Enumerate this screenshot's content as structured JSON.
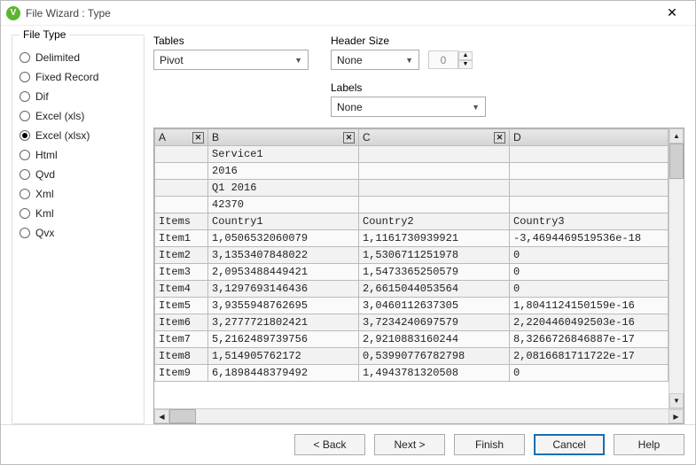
{
  "title": "File Wizard : Type",
  "app_icon_letter": "V",
  "filetype": {
    "legend": "File Type",
    "options": [
      {
        "label": "Delimited",
        "selected": false
      },
      {
        "label": "Fixed Record",
        "selected": false
      },
      {
        "label": "Dif",
        "selected": false
      },
      {
        "label": "Excel (xls)",
        "selected": false
      },
      {
        "label": "Excel (xlsx)",
        "selected": true
      },
      {
        "label": "Html",
        "selected": false
      },
      {
        "label": "Qvd",
        "selected": false
      },
      {
        "label": "Xml",
        "selected": false
      },
      {
        "label": "Kml",
        "selected": false
      },
      {
        "label": "Qvx",
        "selected": false
      }
    ]
  },
  "controls": {
    "tables": {
      "label": "Tables",
      "value": "Pivot"
    },
    "header_size": {
      "label": "Header Size",
      "value": "None",
      "spinner": "0"
    },
    "labels": {
      "label": "Labels",
      "value": "None"
    }
  },
  "grid": {
    "columns": [
      {
        "name": "A",
        "closable": true
      },
      {
        "name": "B",
        "closable": true
      },
      {
        "name": "C",
        "closable": true
      },
      {
        "name": "D",
        "closable": false
      }
    ],
    "rows": [
      {
        "a": "",
        "b": "Service1",
        "c": "",
        "d": ""
      },
      {
        "a": "",
        "b": "2016",
        "c": "",
        "d": ""
      },
      {
        "a": "",
        "b": "Q1 2016",
        "c": "",
        "d": ""
      },
      {
        "a": "",
        "b": "42370",
        "c": "",
        "d": ""
      },
      {
        "a": "Items",
        "b": "Country1",
        "c": "Country2",
        "d": "Country3"
      },
      {
        "a": "Item1",
        "b": "1,0506532060079",
        "c": "1,1161730939921",
        "d": "-3,4694469519536e-18"
      },
      {
        "a": "Item2",
        "b": "3,1353407848022",
        "c": "1,5306711251978",
        "d": "0"
      },
      {
        "a": "Item3",
        "b": "2,0953488449421",
        "c": "1,5473365250579",
        "d": "0"
      },
      {
        "a": "Item4",
        "b": "3,1297693146436",
        "c": "2,6615044053564",
        "d": "0"
      },
      {
        "a": "Item5",
        "b": "3,9355948762695",
        "c": "3,0460112637305",
        "d": "1,8041124150159e-16"
      },
      {
        "a": "Item6",
        "b": "3,2777721802421",
        "c": "3,7234240697579",
        "d": "2,2204460492503e-16"
      },
      {
        "a": "Item7",
        "b": "5,2162489739756",
        "c": "2,9210883160244",
        "d": "8,3266726846887e-17"
      },
      {
        "a": "Item8",
        "b": "1,514905762172",
        "c": "0,53990776782798",
        "d": "2,0816681711722e-17"
      },
      {
        "a": "Item9",
        "b": "6,1898448379492",
        "c": "1,4943781320508",
        "d": "0"
      }
    ]
  },
  "buttons": {
    "back": "< Back",
    "next": "Next >",
    "finish": "Finish",
    "cancel": "Cancel",
    "help": "Help"
  }
}
